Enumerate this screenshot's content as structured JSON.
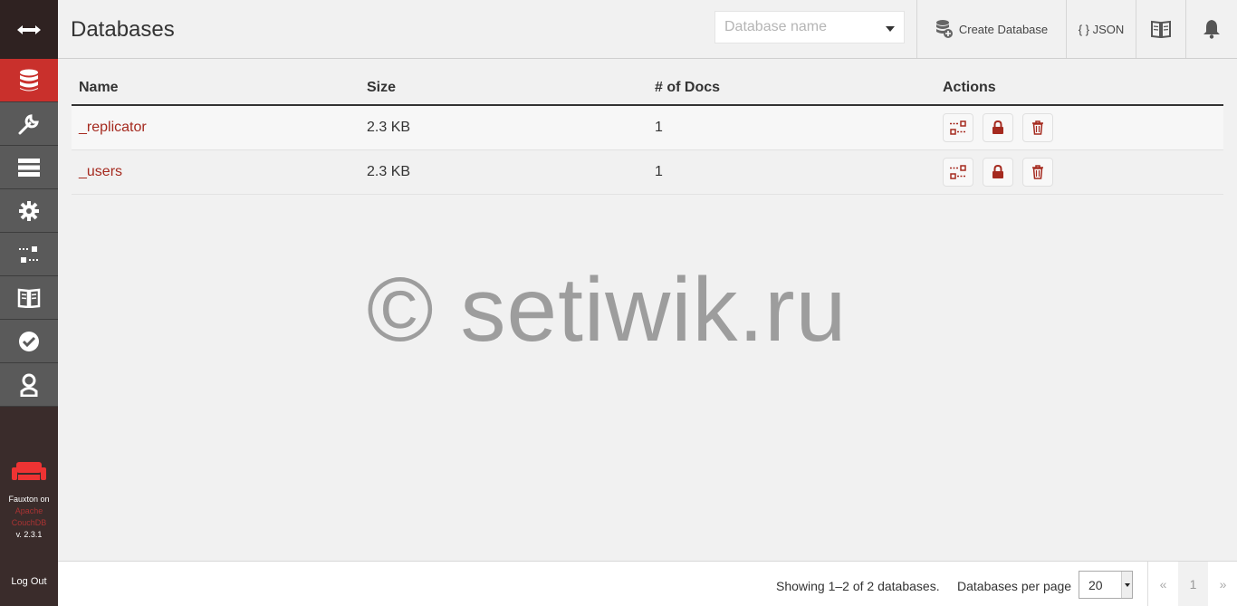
{
  "header": {
    "title": "Databases",
    "search_placeholder": "Database name",
    "create_label": "Create Database",
    "json_label": "{ } JSON"
  },
  "sidebar": {
    "items": [
      "databases",
      "setup",
      "active-tasks",
      "config",
      "replication",
      "documentation",
      "verify",
      "user"
    ],
    "footer": {
      "line1": "Fauxton on",
      "link1": "Apache",
      "link2": "CouchDB",
      "version": "v. 2.3.1"
    },
    "logout": "Log Out"
  },
  "table": {
    "headers": [
      "Name",
      "Size",
      "# of Docs",
      "Actions"
    ],
    "rows": [
      {
        "name": "_replicator",
        "size": "2.3 KB",
        "docs": "1"
      },
      {
        "name": "_users",
        "size": "2.3 KB",
        "docs": "1"
      }
    ]
  },
  "watermark": "© setiwik.ru",
  "footer": {
    "showing": "Showing 1–2 of 2 databases.",
    "per_page_label": "Databases per page",
    "per_page_value": "20",
    "prev": "«",
    "page": "1",
    "next": "»"
  },
  "colors": {
    "accent": "#c9302c",
    "link": "#a52a1f",
    "sidebar_bg": "#3a2c2b",
    "nav_bg": "#5a5a5a"
  }
}
